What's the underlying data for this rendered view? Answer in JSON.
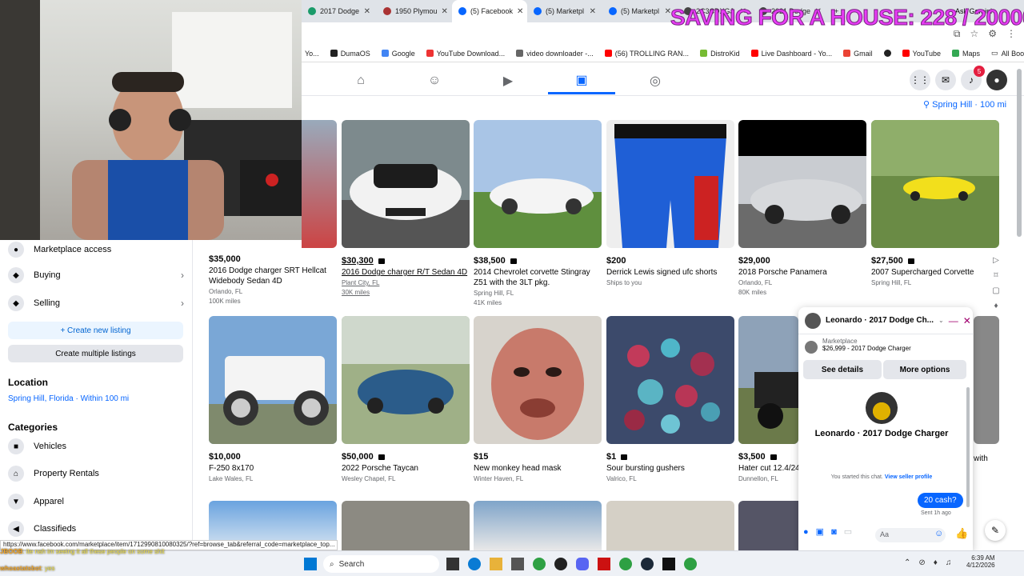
{
  "browser": {
    "tabs": [
      {
        "label": "2017 Dodge",
        "color": "#1a9b6a"
      },
      {
        "label": "1950 Plymou",
        "color": "#a33"
      },
      {
        "label": "(5) Facebook",
        "color": "#0866ff",
        "active": true
      },
      {
        "label": "(5) Marketpl",
        "color": "#0866ff"
      },
      {
        "label": "(5) Marketpl",
        "color": "#0866ff"
      },
      {
        "label": "2C3CDXGJ",
        "color": "#444"
      },
      {
        "label": "2021 Dodge",
        "color": "#444"
      },
      {
        "label": "+",
        "color": "#fff"
      }
    ],
    "ask_gemini": "Ask Gemini",
    "bookmarks": [
      "Yo...",
      "DumaOS",
      "Google",
      "YouTube Download...",
      "video downloader -...",
      "(56) TROLLING RAN...",
      "DistroKid",
      "Live Dashboard - Yo...",
      "Gmail",
      "",
      "YouTube",
      "Maps"
    ],
    "all_bookmarks": "All Bookmarks"
  },
  "overlay_text": "SAVING FOR A HOUSE: 228 / 20000",
  "facebook": {
    "notification_count": "5",
    "location": "Spring Hill · 100 mi"
  },
  "sidebar": {
    "marketplace_access": "Marketplace access",
    "buying": "Buying",
    "selling": "Selling",
    "create_listing": "+ Create new listing",
    "create_multiple": "Create multiple listings",
    "location_heading": "Location",
    "location_value": "Spring Hill, Florida · Within 100 mi",
    "categories_heading": "Categories",
    "categories": [
      "Vehicles",
      "Property Rentals",
      "Apparel",
      "Classifieds"
    ]
  },
  "listings": [
    {
      "price": "$35,000",
      "title": "2016 Dodge charger SRT Hellcat Widebody Sedan 4D",
      "location": "Orlando, FL",
      "miles": "100K miles",
      "video": false
    },
    {
      "price": "$30,300",
      "title": "2016 Dodge charger R/T Sedan 4D",
      "location": "Plant City, FL",
      "miles": "30K miles",
      "video": true
    },
    {
      "price": "$38,500",
      "title": "2014 Chevrolet corvette Stingray Z51 with the 3LT pkg.",
      "location": "Spring Hill, FL",
      "miles": "41K miles",
      "video": true
    },
    {
      "price": "$200",
      "title": "Derrick Lewis signed ufc shorts",
      "location": "Ships to you",
      "miles": "",
      "video": false
    },
    {
      "price": "$29,000",
      "title": "2018 Porsche Panamera",
      "location": "Orlando, FL",
      "miles": "80K miles",
      "video": false
    },
    {
      "price": "$27,500",
      "title": "2007 Supercharged Corvette",
      "location": "Spring Hill, FL",
      "miles": "",
      "video": true
    },
    {
      "price": "$10,000",
      "title": "F-250 8x170",
      "location": "Lake Wales, FL",
      "miles": "",
      "video": false
    },
    {
      "price": "$50,000",
      "title": "2022 Porsche Taycan",
      "location": "Wesley Chapel, FL",
      "miles": "",
      "video": true
    },
    {
      "price": "$15",
      "title": "New monkey head mask",
      "location": "Winter Haven, FL",
      "miles": "",
      "video": false
    },
    {
      "price": "$1",
      "title": "Sour bursting gushers",
      "location": "Valrico, FL",
      "miles": "",
      "video": true
    },
    {
      "price": "$3,500",
      "title": "Hater cut 12.4/24",
      "location": "Dunnellon, FL",
      "miles": "",
      "video": true
    },
    {
      "price": "",
      "title": "with",
      "location": "",
      "miles": "",
      "video": false
    }
  ],
  "chat": {
    "header": "Leonardo · 2017 Dodge Ch...",
    "source": "Marketplace",
    "item": "$26,999 - 2017 Dodge Charger",
    "see_details": "See details",
    "more_options": "More options",
    "name": "Leonardo · 2017 Dodge Charger",
    "started_text": "You started this chat.",
    "view_profile": "View seller profile",
    "message": "20 cash?",
    "sent": "Sent 1h ago",
    "input_placeholder": "Aa"
  },
  "status_url": "https://www.facebook.com/marketplace/item/1712990810080325/?ref=browse_tab&referral_code=marketplace_top...",
  "stream_chat": [
    {
      "user": "JBOOB",
      "text": ": ite nah im seeing it all these people on some shit"
    },
    {
      "user": "whoastatsbot",
      "text": ": yes"
    }
  ],
  "taskbar": {
    "search": "Search",
    "time": "6:39 AM",
    "date": "4/12/2026"
  }
}
